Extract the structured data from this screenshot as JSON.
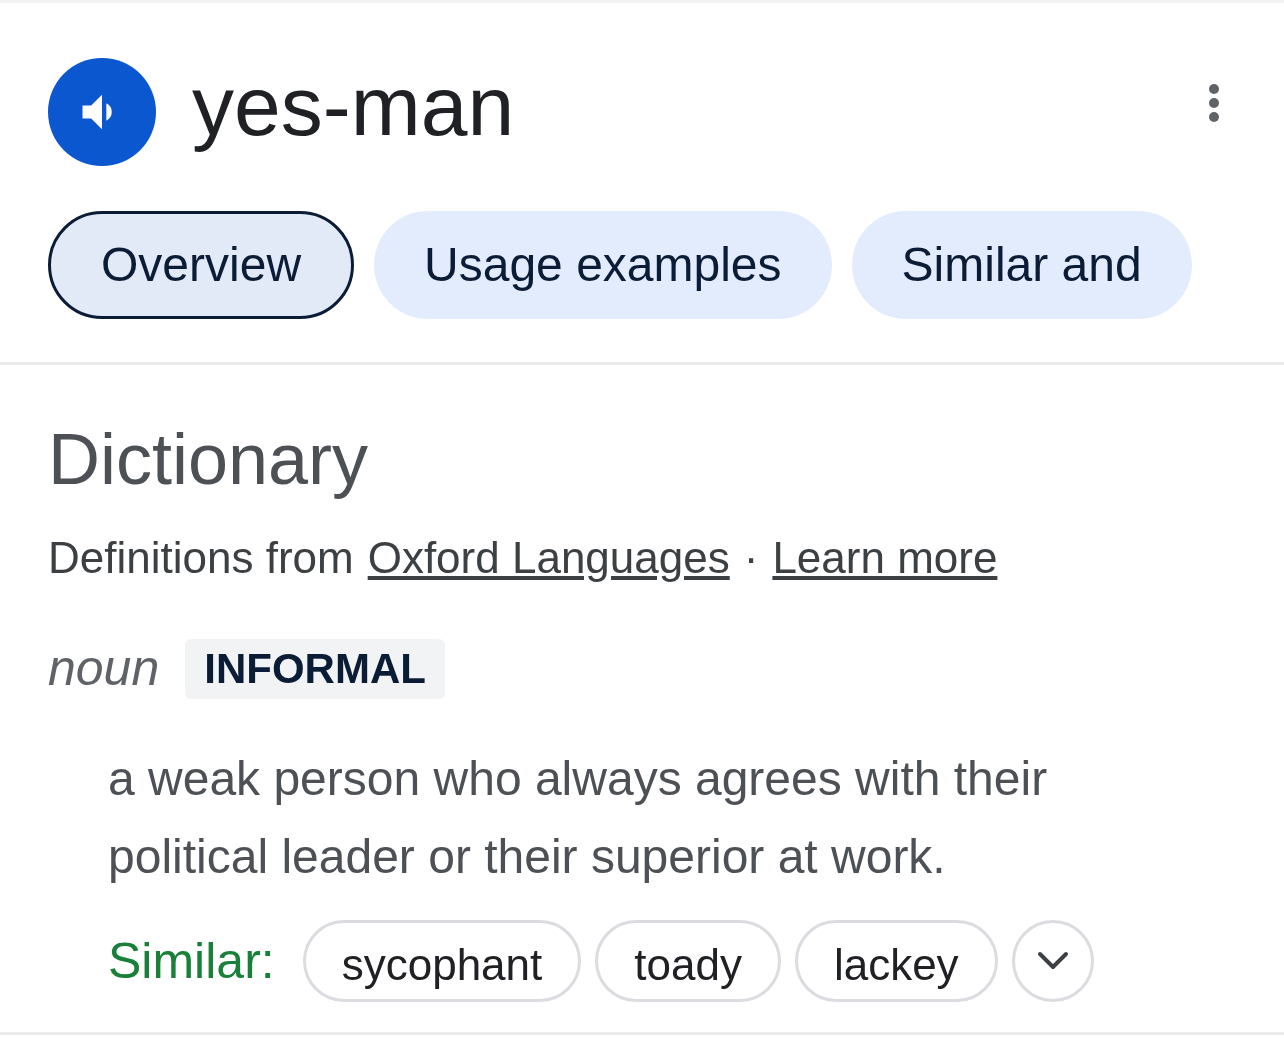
{
  "header": {
    "word": "yes-man"
  },
  "tabs": [
    {
      "label": "Overview",
      "selected": true
    },
    {
      "label": "Usage examples",
      "selected": false
    },
    {
      "label": "Similar and",
      "selected": false
    }
  ],
  "dictionary": {
    "title": "Dictionary",
    "source_prefix": "Definitions from",
    "source_link": "Oxford Languages",
    "separator": "·",
    "learn_more": "Learn more"
  },
  "entry": {
    "part_of_speech": "noun",
    "register": "INFORMAL",
    "definition": "a weak person who always agrees with their political leader or their superior at work.",
    "similar_label": "Similar:",
    "similar": [
      "sycophant",
      "toady",
      "lackey"
    ],
    "expanded": false
  }
}
